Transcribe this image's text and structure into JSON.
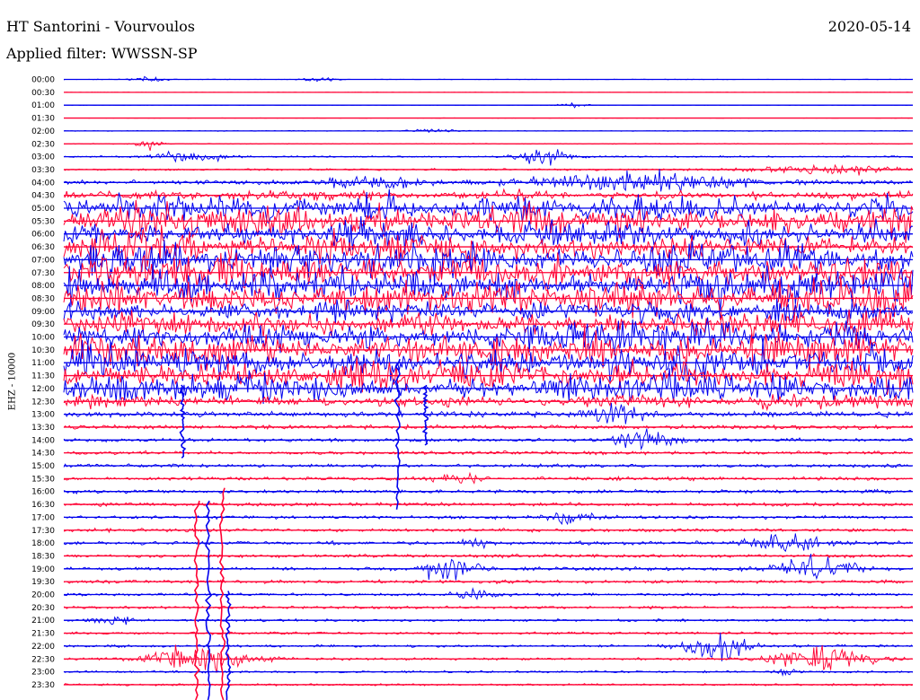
{
  "header": {
    "title": "HT Santorini - Vourvoulos",
    "date": "2020-05-14",
    "filter_line": "Applied filter: WWSSN-SP"
  },
  "channel_label": "EHZ - 10000",
  "colors": {
    "trace_a": "#0000ee",
    "trace_b": "#ff0033",
    "background": "#ffffff",
    "text": "#000000"
  },
  "chart_data": {
    "type": "helicorder",
    "row_minutes": 30,
    "series_colors_alternate": [
      "blue",
      "red"
    ],
    "time_labels": [
      "00:00",
      "00:30",
      "01:00",
      "01:30",
      "02:00",
      "02:30",
      "03:00",
      "03:30",
      "04:00",
      "04:30",
      "05:00",
      "05:30",
      "06:00",
      "06:30",
      "07:00",
      "07:30",
      "08:00",
      "08:30",
      "09:00",
      "09:30",
      "10:00",
      "10:30",
      "11:00",
      "11:30",
      "12:00",
      "12:30",
      "13:00",
      "13:30",
      "14:00",
      "14:30",
      "15:00",
      "15:30",
      "16:00",
      "16:30",
      "17:00",
      "17:30",
      "18:00",
      "18:30",
      "19:00",
      "19:30",
      "20:00",
      "20:30",
      "21:00",
      "21:30",
      "22:00",
      "22:30",
      "23:00",
      "23:30"
    ],
    "noise_level": [
      0.4,
      0.3,
      0.3,
      0.3,
      0.6,
      0.6,
      1.2,
      1.4,
      3,
      6,
      16,
      20,
      18,
      20,
      22,
      20,
      22,
      20,
      14,
      16,
      18,
      20,
      22,
      20,
      16,
      8,
      4,
      3,
      2.5,
      2.5,
      2.5,
      2.5,
      2.5,
      2.5,
      2.5,
      2.5,
      2.5,
      2.5,
      2.5,
      2.5,
      2,
      2,
      1.8,
      1.8,
      1.8,
      1.8,
      1.6,
      1.5
    ],
    "events": [
      {
        "row": 0,
        "minute": 3.0,
        "amp": 4,
        "width": 0.4
      },
      {
        "row": 0,
        "minute": 9.0,
        "amp": 4,
        "width": 0.4
      },
      {
        "row": 2,
        "minute": 18.0,
        "amp": 3,
        "width": 0.4
      },
      {
        "row": 4,
        "minute": 13.0,
        "amp": 4,
        "width": 0.5
      },
      {
        "row": 5,
        "minute": 3.0,
        "amp": 9,
        "width": 0.3
      },
      {
        "row": 6,
        "minute": 4.5,
        "amp": 10,
        "width": 0.8
      },
      {
        "row": 6,
        "minute": 17.0,
        "amp": 16,
        "width": 0.6
      },
      {
        "row": 7,
        "minute": 27.0,
        "amp": 8,
        "width": 1.5
      },
      {
        "row": 8,
        "minute": 20.5,
        "amp": 14,
        "width": 2.5
      },
      {
        "row": 8,
        "minute": 11.0,
        "amp": 10,
        "width": 1.2
      },
      {
        "row": 26,
        "minute": 19.5,
        "amp": 14,
        "width": 0.8
      },
      {
        "row": 28,
        "minute": 20.5,
        "amp": 14,
        "width": 0.8
      },
      {
        "row": 31,
        "minute": 14.0,
        "amp": 8,
        "width": 0.6
      },
      {
        "row": 34,
        "minute": 18.0,
        "amp": 8,
        "width": 0.6
      },
      {
        "row": 36,
        "minute": 25.5,
        "amp": 18,
        "width": 0.8
      },
      {
        "row": 36,
        "minute": 14.5,
        "amp": 7,
        "width": 0.4
      },
      {
        "row": 38,
        "minute": 13.5,
        "amp": 18,
        "width": 0.7
      },
      {
        "row": 38,
        "minute": 26.5,
        "amp": 18,
        "width": 0.9
      },
      {
        "row": 40,
        "minute": 14.5,
        "amp": 6,
        "width": 0.6
      },
      {
        "row": 42,
        "minute": 1.8,
        "amp": 6,
        "width": 0.4
      },
      {
        "row": 44,
        "minute": 23.0,
        "amp": 20,
        "width": 0.8
      },
      {
        "row": 45,
        "minute": 4.8,
        "amp": 22,
        "width": 1.2
      },
      {
        "row": 45,
        "minute": 26.8,
        "amp": 20,
        "width": 1.1
      },
      {
        "row": 46,
        "minute": 25.5,
        "amp": 6,
        "width": 0.3
      }
    ],
    "spikes": [
      {
        "row": 37,
        "minute": 4.7,
        "top_row": 33,
        "bottom_row": 47
      },
      {
        "row": 38,
        "minute": 5.1,
        "top_row": 33,
        "bottom_row": 47
      },
      {
        "row": 37,
        "minute": 5.6,
        "top_row": 32,
        "bottom_row": 47
      },
      {
        "row": 38,
        "minute": 5.8,
        "top_row": 40,
        "bottom_row": 47
      },
      {
        "row": 22,
        "minute": 11.8,
        "top_row": 22,
        "bottom_row": 32
      },
      {
        "row": 24,
        "minute": 12.8,
        "top_row": 24,
        "bottom_row": 27
      },
      {
        "row": 24,
        "minute": 4.2,
        "top_row": 24,
        "bottom_row": 28
      }
    ]
  }
}
